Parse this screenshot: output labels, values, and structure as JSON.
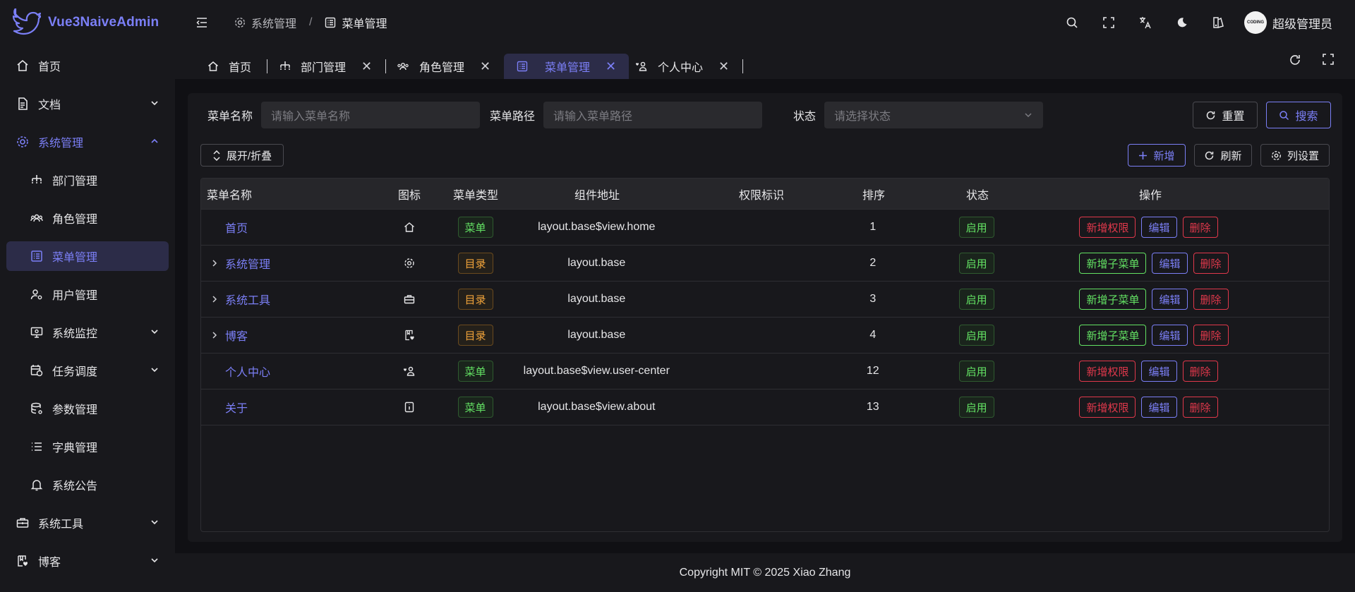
{
  "app": {
    "name": "Vue3NaiveAdmin",
    "accent": "#7b7ff6"
  },
  "sidebar": {
    "items": [
      {
        "label": "首页"
      },
      {
        "label": "文档"
      },
      {
        "label": "系统管理"
      },
      {
        "label": "部门管理"
      },
      {
        "label": "角色管理"
      },
      {
        "label": "菜单管理"
      },
      {
        "label": "用户管理"
      },
      {
        "label": "系统监控"
      },
      {
        "label": "任务调度"
      },
      {
        "label": "参数管理"
      },
      {
        "label": "字典管理"
      },
      {
        "label": "系统公告"
      },
      {
        "label": "系统工具"
      },
      {
        "label": "博客"
      }
    ]
  },
  "breadcrumb": {
    "parent": "系统管理",
    "separator": "/",
    "current": "菜单管理"
  },
  "header": {
    "user_name": "超级管理员",
    "avatar_text": "CODING"
  },
  "tabs": [
    {
      "label": "首页"
    },
    {
      "label": "部门管理"
    },
    {
      "label": "角色管理"
    },
    {
      "label": "菜单管理"
    },
    {
      "label": "个人中心"
    }
  ],
  "search": {
    "name_label": "菜单名称",
    "name_placeholder": "请输入菜单名称",
    "path_label": "菜单路径",
    "path_placeholder": "请输入菜单路径",
    "status_label": "状态",
    "status_placeholder": "请选择状态",
    "reset": "重置",
    "search": "搜索"
  },
  "toolbar": {
    "expand": "展开/折叠",
    "add": "新增",
    "refresh": "刷新",
    "columns": "列设置"
  },
  "table": {
    "headers": [
      "菜单名称",
      "图标",
      "菜单类型",
      "组件地址",
      "权限标识",
      "排序",
      "状态",
      "操作"
    ],
    "rows": [
      {
        "name": "首页",
        "icon": "home-icon",
        "type": "菜单",
        "component": "layout.base$view.home",
        "perm": "",
        "sort": "1",
        "status": "启用",
        "action1": "新增权限",
        "edit": "编辑",
        "delete": "删除"
      },
      {
        "name": "系统管理",
        "icon": "gear-icon",
        "type": "目录",
        "component": "layout.base",
        "perm": "",
        "sort": "2",
        "status": "启用",
        "action1": "新增子菜单",
        "edit": "编辑",
        "delete": "删除"
      },
      {
        "name": "系统工具",
        "icon": "toolbox-icon",
        "type": "目录",
        "component": "layout.base",
        "perm": "",
        "sort": "3",
        "status": "启用",
        "action1": "新增子菜单",
        "edit": "编辑",
        "delete": "删除"
      },
      {
        "name": "博客",
        "icon": "blog-icon",
        "type": "目录",
        "component": "layout.base",
        "perm": "",
        "sort": "4",
        "status": "启用",
        "action1": "新增子菜单",
        "edit": "编辑",
        "delete": "删除"
      },
      {
        "name": "个人中心",
        "icon": "user-center-icon",
        "type": "菜单",
        "component": "layout.base$view.user-center",
        "perm": "",
        "sort": "12",
        "status": "启用",
        "action1": "新增权限",
        "edit": "编辑",
        "delete": "删除"
      },
      {
        "name": "关于",
        "icon": "info-icon",
        "type": "菜单",
        "component": "layout.base$view.about",
        "perm": "",
        "sort": "13",
        "status": "启用",
        "action1": "新增权限",
        "edit": "编辑",
        "delete": "删除"
      }
    ]
  },
  "footer": {
    "text": "Copyright MIT © 2025 Xiao Zhang"
  }
}
